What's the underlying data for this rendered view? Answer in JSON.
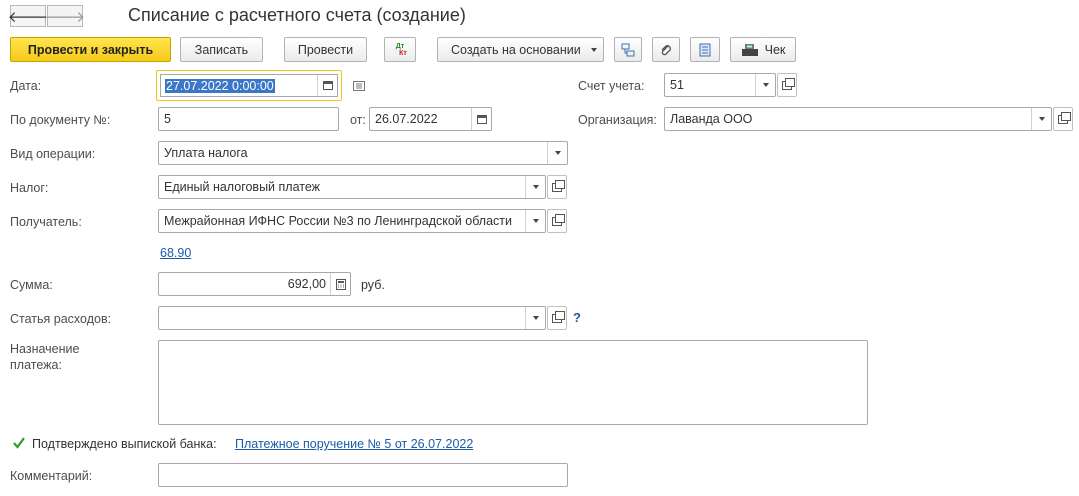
{
  "window": {
    "title": "Списание с расчетного счета (создание)",
    "back_glyph": "🡐",
    "forward_glyph": "🡒"
  },
  "toolbar": {
    "post_and_close": "Провести и закрыть",
    "save": "Записать",
    "post": "Провести",
    "dt_kt_top": "Дт",
    "dt_kt_bottom": "Кт",
    "create_based_on": "Создать на основании",
    "check": "Чек"
  },
  "form": {
    "date": {
      "label": "Дата:",
      "value": "27.07.2022  0:00:00"
    },
    "account": {
      "label": "Счет учета:",
      "value": "51"
    },
    "doc_number": {
      "label": "По документу №:",
      "value": "5",
      "from_label": "от:",
      "from_date": "26.07.2022"
    },
    "organization": {
      "label": "Организация:",
      "value": "Лаванда ООО"
    },
    "operation_type": {
      "label": "Вид операции:",
      "value": "Уплата налога"
    },
    "tax": {
      "label": "Налог:",
      "value": "Единый налоговый платеж"
    },
    "recipient": {
      "label": "Получатель:",
      "value": "Межрайонная ИФНС России №3 по Ленинградской области"
    },
    "account_link": "68.90",
    "amount": {
      "label": "Сумма:",
      "value": "692,00",
      "currency": "руб."
    },
    "expense_item": {
      "label": "Статья расходов:",
      "value": "",
      "help": "?"
    },
    "purpose": {
      "label_line1": "Назначение",
      "label_line2": "платежа:",
      "value": ""
    },
    "bank_confirmed": {
      "label": "Подтверждено выпиской банка:",
      "checked": true,
      "link": "Платежное поручение № 5 от 26.07.2022"
    },
    "comment": {
      "label": "Комментарий:",
      "value": ""
    }
  },
  "colors": {
    "accent": "#f5cb1a",
    "link": "#1c5ca8",
    "focus": "#f0c419",
    "selection": "#3a77c8"
  }
}
